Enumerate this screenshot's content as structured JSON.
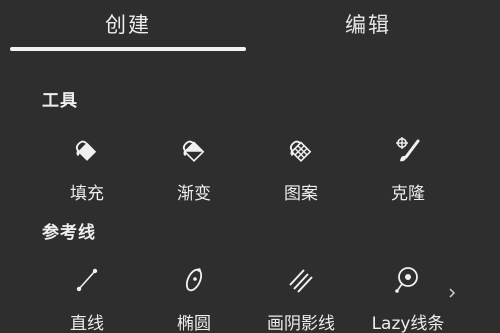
{
  "tabs": [
    {
      "label": "创建",
      "active": true
    },
    {
      "label": "编辑",
      "active": false
    }
  ],
  "sections": {
    "tools": {
      "title": "工具",
      "items": [
        {
          "label": "填充",
          "icon": "fill-bucket-icon"
        },
        {
          "label": "渐变",
          "icon": "gradient-icon"
        },
        {
          "label": "图案",
          "icon": "pattern-icon"
        },
        {
          "label": "克隆",
          "icon": "clone-icon"
        }
      ]
    },
    "guides": {
      "title": "参考线",
      "items": [
        {
          "label": "直线",
          "icon": "straight-line-icon"
        },
        {
          "label": "椭圆",
          "icon": "ellipse-icon"
        },
        {
          "label": "画阴影线",
          "icon": "hatch-lines-icon"
        },
        {
          "label": "Lazy线条",
          "icon": "lazy-line-icon"
        }
      ]
    }
  },
  "more_icon": "chevron-right-icon",
  "colors": {
    "background": "#2e2e2e",
    "text": "#ededed",
    "indicator": "#f2f2f2"
  }
}
